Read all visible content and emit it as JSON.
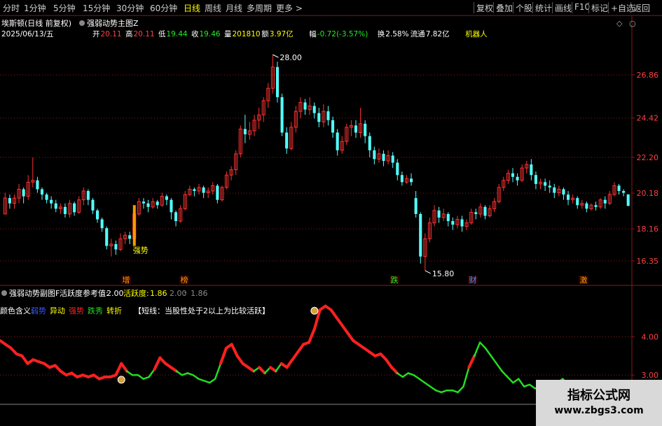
{
  "toolbar": {
    "periods": [
      "分时",
      "1分钟",
      "5分钟",
      "15分钟",
      "30分钟",
      "60分钟",
      "日线",
      "周线",
      "月线",
      "多周期",
      "更多"
    ],
    "active_period": "日线",
    "right_items": [
      "复权",
      "叠加",
      "个股",
      "统计",
      "画线",
      "F10",
      "标记",
      "+自选",
      "返回"
    ]
  },
  "info": {
    "title": "埃斯顿(日线 前复权)",
    "indicator_main": "强弱动势主图Z",
    "date": "2025/06/13/五",
    "open_label": "开",
    "open": "20.11",
    "high_label": "高",
    "high": "20.11",
    "low_label": "低",
    "low": "19.44",
    "close_label": "收",
    "close": "19.46",
    "vol_label": "量",
    "vol": "201810",
    "amt_label": "额",
    "amt": "3.97亿",
    "chg_label": "幅",
    "chg": "-0.72(-3.57%)",
    "turn_label": "换",
    "turn": "2.58%",
    "float_label": "流通",
    "float": "7.82亿",
    "concept": "机器人"
  },
  "price_axis": [
    "26.86",
    "24.42",
    "22.20",
    "20.18",
    "18.16",
    "16.35"
  ],
  "annotations": {
    "high_marker": "28.00",
    "low_marker": "15.80",
    "strong_label": "强势"
  },
  "event_labels": [
    "增",
    "榜",
    "跌",
    "财",
    "激"
  ],
  "sub": {
    "indicator_name": "强弱动势副图F",
    "ref_label": "活跃度参考值:",
    "ref_value": "2.00",
    "act_label": "活跃度:",
    "act_value": "1.86",
    "extra1": "2.00",
    "extra2": "1.86",
    "legend_title": "颜色含义:",
    "legend": [
      {
        "text": "弱势",
        "color": "#3355ff"
      },
      {
        "text": "异动",
        "color": "#ffff00"
      },
      {
        "text": "强势",
        "color": "#ff2020"
      },
      {
        "text": "跌秀",
        "color": "#22dd22"
      },
      {
        "text": "转折",
        "color": "#ffff00"
      }
    ],
    "note": "【短线：当股性处于2以上为比较活跃】",
    "axis": [
      "4.00",
      "3.00"
    ]
  },
  "colors": {
    "up": "#ff3232",
    "down": "#54ffff",
    "grid": "#8b1a1a",
    "axis_text": "#ff4040"
  },
  "watermark": {
    "title": "指标公式网",
    "url": "www.zbgs3.com"
  },
  "chart_data": {
    "type": "candlestick",
    "price_range": [
      15.8,
      28.0
    ],
    "candles": [
      [
        19.0,
        19.9,
        19.0,
        20.2
      ],
      [
        19.9,
        19.6,
        19.3,
        20.1
      ],
      [
        19.6,
        19.9,
        19.3,
        20.1
      ],
      [
        19.9,
        20.4,
        19.6,
        20.7
      ],
      [
        20.4,
        20.0,
        19.6,
        20.5
      ],
      [
        20.0,
        20.8,
        19.8,
        21.2
      ],
      [
        20.8,
        20.9,
        20.5,
        22.2
      ],
      [
        20.9,
        20.4,
        20.2,
        21.1
      ],
      [
        20.4,
        20.1,
        19.8,
        20.5
      ],
      [
        20.1,
        19.8,
        19.6,
        20.2
      ],
      [
        19.8,
        19.6,
        19.3,
        20.0
      ],
      [
        19.6,
        19.3,
        19.1,
        19.8
      ],
      [
        19.3,
        19.4,
        19.0,
        19.6
      ],
      [
        19.4,
        19.0,
        18.8,
        19.6
      ],
      [
        19.0,
        19.6,
        18.8,
        19.8
      ],
      [
        19.6,
        19.1,
        18.9,
        19.7
      ],
      [
        19.1,
        19.8,
        19.0,
        20.0
      ],
      [
        19.8,
        20.3,
        19.5,
        20.5
      ],
      [
        20.3,
        19.8,
        19.5,
        20.4
      ],
      [
        19.8,
        19.2,
        19.0,
        19.9
      ],
      [
        19.2,
        18.7,
        18.5,
        19.3
      ],
      [
        18.7,
        18.2,
        18.0,
        18.8
      ],
      [
        18.2,
        17.2,
        17.0,
        18.3
      ],
      [
        17.2,
        17.3,
        16.6,
        17.6
      ],
      [
        17.3,
        17.0,
        16.7,
        17.5
      ],
      [
        17.0,
        17.6,
        16.9,
        17.9
      ],
      [
        17.6,
        17.8,
        17.3,
        18.0
      ],
      [
        17.8,
        17.6,
        17.3,
        18.0
      ],
      [
        17.6,
        19.0,
        17.5,
        19.1
      ],
      [
        19.0,
        19.7,
        18.9,
        19.9
      ],
      [
        19.7,
        19.6,
        19.3,
        19.9
      ],
      [
        19.6,
        19.4,
        19.1,
        19.8
      ],
      [
        19.4,
        19.7,
        19.3,
        19.9
      ],
      [
        19.7,
        19.5,
        19.3,
        19.8
      ],
      [
        19.5,
        20.0,
        19.4,
        20.2
      ],
      [
        20.0,
        19.8,
        19.5,
        20.1
      ],
      [
        19.8,
        19.1,
        18.7,
        19.9
      ],
      [
        19.1,
        18.6,
        18.3,
        19.2
      ],
      [
        18.6,
        19.3,
        18.5,
        19.5
      ],
      [
        19.3,
        20.1,
        19.2,
        20.3
      ],
      [
        20.1,
        20.4,
        20.0,
        20.6
      ],
      [
        20.4,
        20.3,
        20.0,
        20.5
      ],
      [
        20.3,
        20.5,
        20.1,
        20.7
      ],
      [
        20.5,
        20.2,
        19.9,
        20.6
      ],
      [
        20.2,
        20.3,
        19.9,
        20.5
      ],
      [
        20.3,
        20.6,
        20.1,
        20.8
      ],
      [
        20.6,
        19.8,
        19.6,
        20.7
      ],
      [
        19.8,
        20.5,
        19.7,
        20.6
      ],
      [
        20.5,
        21.2,
        20.4,
        21.4
      ],
      [
        21.2,
        21.5,
        20.9,
        21.7
      ],
      [
        21.5,
        22.4,
        21.2,
        22.6
      ],
      [
        22.4,
        23.8,
        22.2,
        24.0
      ],
      [
        23.8,
        23.5,
        23.0,
        24.6
      ],
      [
        23.5,
        23.7,
        23.2,
        24.2
      ],
      [
        23.7,
        24.3,
        23.4,
        24.6
      ],
      [
        24.3,
        24.6,
        23.8,
        25.0
      ],
      [
        24.6,
        25.4,
        24.2,
        25.6
      ],
      [
        25.4,
        26.1,
        25.0,
        26.4
      ],
      [
        26.1,
        27.3,
        25.8,
        28.0
      ],
      [
        27.3,
        25.6,
        25.3,
        27.6
      ],
      [
        25.6,
        23.6,
        23.4,
        25.8
      ],
      [
        23.6,
        22.7,
        22.4,
        23.9
      ],
      [
        22.7,
        23.9,
        22.6,
        24.2
      ],
      [
        23.9,
        24.8,
        23.6,
        25.1
      ],
      [
        24.8,
        25.3,
        24.4,
        25.6
      ],
      [
        25.3,
        24.9,
        24.6,
        25.5
      ],
      [
        24.9,
        25.1,
        24.6,
        25.6
      ],
      [
        25.1,
        24.7,
        24.4,
        25.3
      ],
      [
        24.7,
        24.2,
        23.9,
        25.0
      ],
      [
        24.2,
        24.8,
        23.9,
        25.2
      ],
      [
        24.8,
        24.3,
        24.0,
        25.1
      ],
      [
        24.3,
        23.6,
        23.3,
        24.5
      ],
      [
        23.6,
        22.6,
        22.3,
        23.8
      ],
      [
        22.6,
        23.1,
        22.4,
        23.4
      ],
      [
        23.1,
        23.9,
        22.9,
        24.1
      ],
      [
        23.9,
        24.0,
        23.4,
        24.3
      ],
      [
        24.0,
        23.6,
        23.3,
        24.3
      ],
      [
        23.6,
        24.1,
        23.3,
        25.0
      ],
      [
        24.1,
        23.4,
        23.0,
        24.3
      ],
      [
        23.4,
        22.6,
        22.2,
        23.6
      ],
      [
        22.6,
        22.1,
        21.8,
        22.8
      ],
      [
        22.1,
        22.4,
        21.9,
        22.7
      ],
      [
        22.4,
        22.0,
        21.7,
        22.6
      ],
      [
        22.0,
        22.3,
        21.8,
        22.6
      ],
      [
        22.3,
        21.9,
        21.6,
        22.5
      ],
      [
        21.9,
        21.2,
        20.9,
        22.1
      ],
      [
        21.2,
        20.8,
        20.6,
        21.4
      ],
      [
        20.8,
        21.0,
        20.7,
        21.2
      ],
      [
        21.0,
        20.8,
        20.6,
        21.3
      ],
      [
        19.9,
        19.0,
        18.8,
        20.3
      ],
      [
        19.0,
        16.6,
        16.2,
        19.1
      ],
      [
        16.6,
        17.6,
        15.8,
        17.9
      ],
      [
        17.6,
        18.5,
        17.4,
        18.8
      ],
      [
        18.5,
        19.2,
        18.3,
        19.5
      ],
      [
        19.2,
        18.8,
        18.5,
        19.4
      ],
      [
        18.8,
        19.0,
        18.6,
        19.3
      ],
      [
        19.0,
        18.6,
        18.3,
        19.1
      ],
      [
        18.6,
        18.4,
        18.1,
        18.8
      ],
      [
        18.4,
        18.7,
        18.2,
        18.9
      ],
      [
        18.7,
        18.3,
        18.0,
        18.9
      ],
      [
        18.3,
        18.5,
        18.1,
        18.7
      ],
      [
        18.5,
        19.1,
        18.4,
        19.3
      ],
      [
        19.1,
        19.0,
        18.7,
        19.3
      ],
      [
        19.0,
        19.4,
        18.8,
        19.6
      ],
      [
        19.4,
        18.9,
        18.7,
        19.5
      ],
      [
        18.9,
        19.3,
        18.8,
        19.5
      ],
      [
        19.3,
        19.7,
        19.1,
        19.9
      ],
      [
        19.7,
        20.5,
        19.6,
        20.7
      ],
      [
        20.5,
        20.9,
        20.3,
        21.1
      ],
      [
        20.9,
        21.3,
        20.7,
        21.5
      ],
      [
        21.3,
        21.1,
        20.8,
        21.6
      ],
      [
        21.1,
        20.9,
        20.6,
        21.3
      ],
      [
        20.9,
        21.6,
        20.8,
        21.8
      ],
      [
        21.6,
        21.8,
        21.3,
        22.0
      ],
      [
        21.8,
        21.2,
        20.9,
        22.1
      ],
      [
        21.2,
        20.7,
        20.4,
        21.4
      ],
      [
        20.7,
        20.8,
        20.4,
        21.0
      ],
      [
        20.8,
        20.6,
        20.3,
        21.0
      ],
      [
        20.6,
        20.5,
        20.2,
        20.9
      ],
      [
        20.5,
        20.2,
        19.9,
        20.7
      ],
      [
        20.2,
        20.4,
        20.0,
        20.6
      ],
      [
        20.4,
        20.1,
        19.8,
        20.5
      ],
      [
        20.1,
        19.8,
        19.5,
        20.3
      ],
      [
        19.8,
        19.9,
        19.6,
        20.1
      ],
      [
        19.9,
        19.5,
        19.3,
        20.0
      ],
      [
        19.5,
        19.6,
        19.3,
        19.8
      ],
      [
        19.6,
        19.3,
        19.1,
        19.7
      ],
      [
        19.3,
        19.5,
        19.2,
        19.6
      ],
      [
        19.5,
        19.4,
        19.2,
        19.7
      ],
      [
        19.4,
        19.8,
        19.3,
        19.9
      ],
      [
        19.8,
        19.6,
        19.3,
        20.0
      ],
      [
        19.6,
        20.1,
        19.5,
        20.3
      ],
      [
        20.1,
        20.6,
        20.0,
        20.8
      ],
      [
        20.6,
        20.3,
        20.1,
        20.7
      ],
      [
        20.3,
        20.2,
        20.0,
        20.4
      ],
      [
        20.11,
        19.46,
        19.44,
        20.11
      ]
    ],
    "oscillator": {
      "range": [
        2.2,
        4.9
      ],
      "values": [
        3.9,
        3.8,
        3.7,
        3.55,
        3.5,
        3.3,
        3.4,
        3.35,
        3.3,
        3.2,
        3.25,
        3.1,
        3.0,
        3.05,
        2.95,
        3.0,
        2.95,
        3.0,
        2.9,
        2.95,
        2.95,
        3.0,
        3.3,
        3.1,
        3.0,
        3.0,
        2.9,
        2.95,
        3.15,
        3.45,
        3.3,
        3.2,
        3.1,
        3.0,
        3.05,
        3.0,
        2.9,
        2.85,
        2.8,
        2.9,
        3.3,
        3.7,
        3.8,
        3.5,
        3.3,
        3.2,
        3.1,
        3.2,
        3.05,
        3.2,
        3.1,
        3.3,
        3.2,
        3.4,
        3.6,
        3.8,
        3.85,
        4.2,
        4.7,
        4.8,
        4.7,
        4.5,
        4.3,
        4.1,
        3.9,
        3.8,
        3.7,
        3.6,
        3.5,
        3.55,
        3.4,
        3.2,
        3.05,
        2.95,
        3.05,
        3.0,
        2.9,
        2.8,
        2.7,
        2.6,
        2.55,
        2.6,
        2.6,
        2.55,
        2.7,
        3.2,
        3.5,
        3.85,
        3.7,
        3.5,
        3.3,
        3.1,
        2.95,
        2.8,
        2.9,
        2.7,
        2.75,
        2.65,
        2.7,
        2.6,
        2.7,
        2.8,
        2.9,
        2.75,
        2.6,
        2.65,
        2.55,
        2.5,
        2.7,
        2.75,
        2.6,
        2.45,
        2.35
      ]
    }
  }
}
